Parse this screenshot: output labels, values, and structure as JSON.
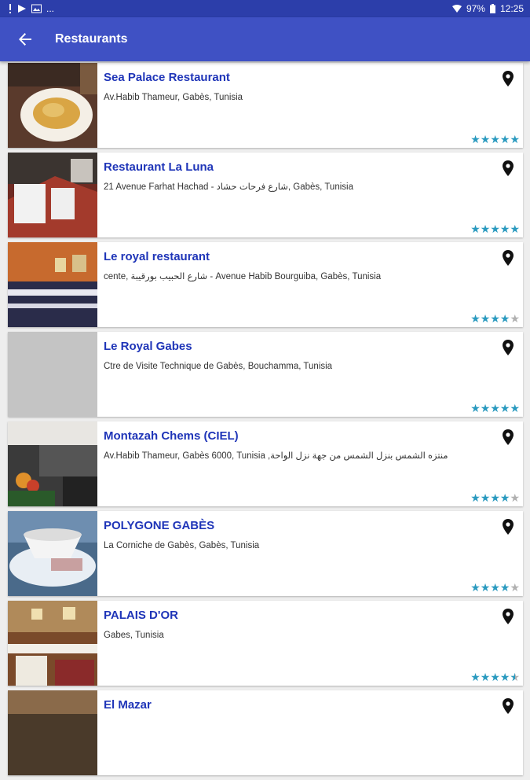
{
  "status_bar": {
    "left_text": "...",
    "battery": "97%",
    "time": "12:25"
  },
  "app_bar": {
    "title": "Restaurants",
    "back_icon": "back-arrow-icon"
  },
  "restaurants": [
    {
      "name": "Sea Palace Restaurant",
      "address": "Av.Habib Thameur, Gabès, Tunisia",
      "rating": 5
    },
    {
      "name": "Restaurant La Luna",
      "address": "21 Avenue Farhat Hachad - شارع فرحات حشاد, Gabès, Tunisia",
      "rating": 5
    },
    {
      "name": "Le royal restaurant",
      "address": "cente, شارع الحبيب بورقيبة - Avenue Habib Bourguiba, Gabès, Tunisia",
      "rating": 4
    },
    {
      "name": "Le Royal Gabes",
      "address": "Ctre de Visite Technique de Gabès, Bouchamma, Tunisia",
      "rating": 5
    },
    {
      "name": "Montazah Chems (CIEL)",
      "address": "Av.Habib Thameur, Gabès 6000, Tunisia ,منتزه الشمس بنزل الشمس من جهة نزل الواحة",
      "rating": 4
    },
    {
      "name": "POLYGONE GABÈS",
      "address": "La Corniche de Gabès, Gabès, Tunisia",
      "rating": 4
    },
    {
      "name": "PALAIS D'OR",
      "address": "Gabes, Tunisia",
      "rating": 4.5
    },
    {
      "name": "El Mazar",
      "address": "",
      "rating": 0
    }
  ],
  "colors": {
    "status_bar": "#2c3eaa",
    "app_bar": "#3f51c4",
    "title_text": "#1f35b8",
    "star": "#2a9abf",
    "star_empty": "#b0b0b0"
  }
}
